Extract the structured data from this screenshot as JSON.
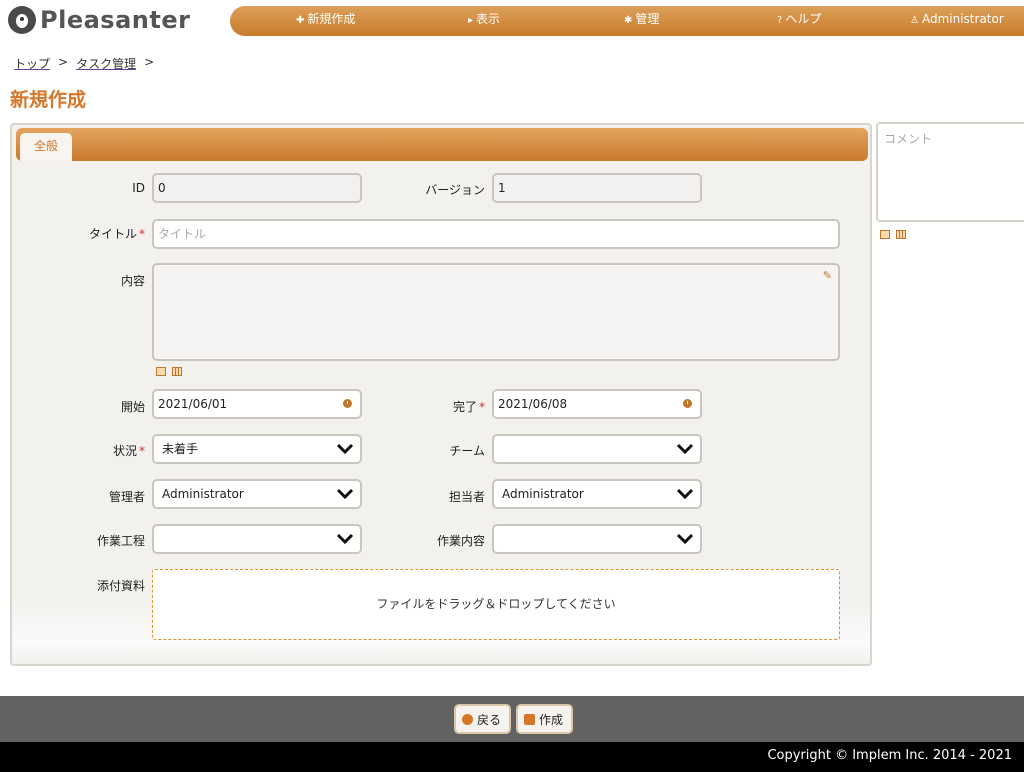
{
  "logo": {
    "text": "Pleasanter"
  },
  "nav": {
    "new": "新規作成",
    "view": "表示",
    "admin": "管理",
    "help": "ヘルプ",
    "user": "Administrator"
  },
  "breadcrumb": {
    "top": "トップ",
    "task": "タスク管理",
    "sep": ">"
  },
  "page_title": "新規作成",
  "tabs": {
    "general": "全般"
  },
  "form": {
    "id_label": "ID",
    "id_value": "0",
    "version_label": "バージョン",
    "version_value": "1",
    "title_label": "タイトル",
    "title_placeholder": "タイトル",
    "body_label": "内容",
    "start_label": "開始",
    "start_value": "2021/06/01",
    "complete_label": "完了",
    "complete_value": "2021/06/08",
    "status_label": "状況",
    "status_value": "未着手",
    "team_label": "チーム",
    "team_value": "",
    "manager_label": "管理者",
    "manager_value": "Administrator",
    "owner_label": "担当者",
    "owner_value": "Administrator",
    "process_label": "作業工程",
    "process_value": "",
    "work_label": "作業内容",
    "work_value": "",
    "attach_label": "添付資料",
    "dropzone_text": "ファイルをドラッグ＆ドロップしてください",
    "required_mark": "*"
  },
  "comment": {
    "placeholder": "コメント"
  },
  "footer": {
    "back": "戻る",
    "create": "作成",
    "copyright": "Copyright © Implem Inc. 2014 - 2021"
  },
  "colors": {
    "accent": "#d5762a",
    "nav": "#c87a28"
  }
}
